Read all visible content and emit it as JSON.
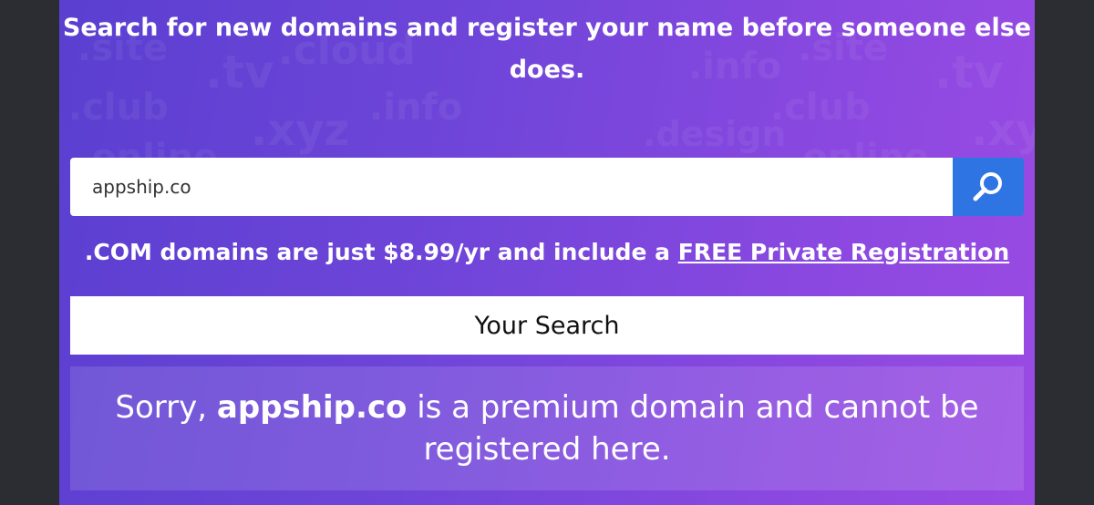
{
  "hero": {
    "headline": "Search for new domains and register your name before someone else does."
  },
  "background_tlds": [
    ".site",
    ".tv",
    ".cloud",
    ".info",
    ".club",
    ".xyz",
    ".design",
    ".online",
    ".site",
    ".tv",
    ".club",
    ".xyz",
    ".info",
    ".online"
  ],
  "search": {
    "value": "appship.co",
    "button_icon": "search-icon"
  },
  "promo": {
    "text_prefix": ".COM domains are just $8.99/yr and include a ",
    "link_text": "FREE Private Registration"
  },
  "results": {
    "header": "Your Search",
    "message_prefix": "Sorry, ",
    "domain": "appship.co",
    "message_suffix": " is a premium domain and cannot be registered here."
  },
  "colors": {
    "panel_start": "#5a3fd0",
    "panel_end": "#9a4be3",
    "search_button": "#2f74e3",
    "page_background": "#2b2d33"
  }
}
